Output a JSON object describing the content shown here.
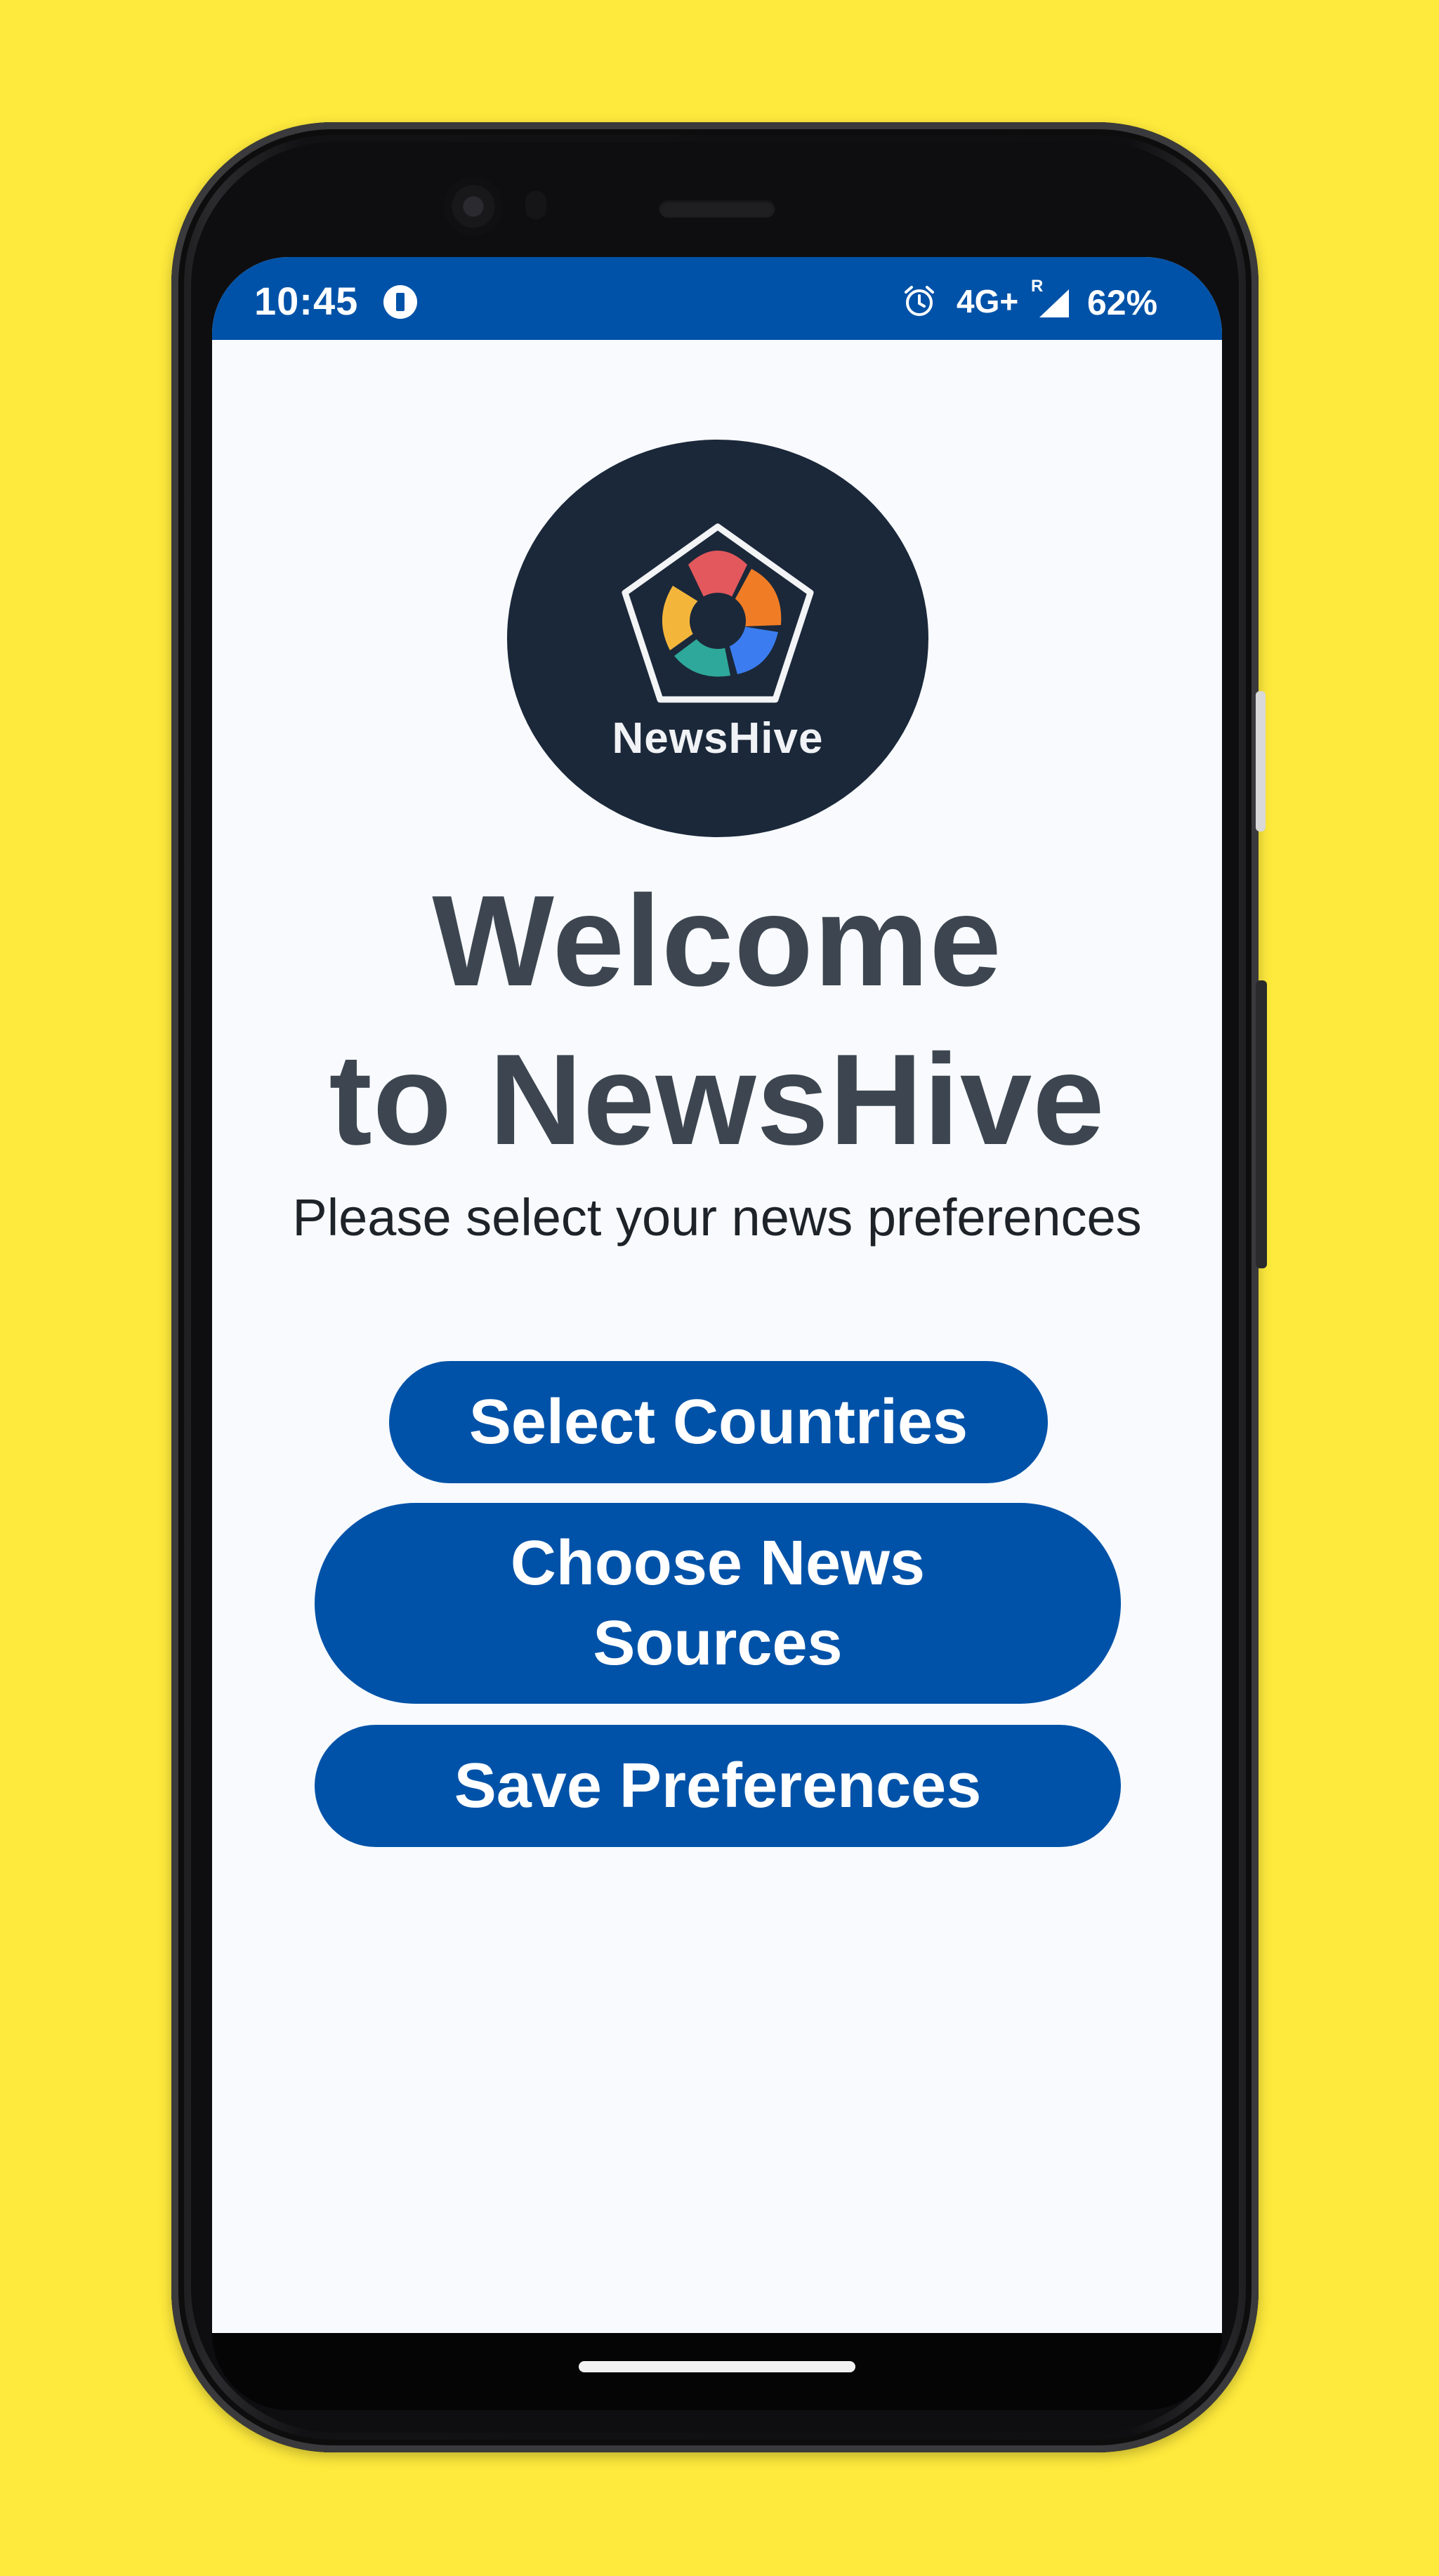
{
  "status_bar": {
    "time": "10:45",
    "network": "4G+",
    "roaming": "R",
    "battery": "62%",
    "icons": [
      "notification-icon",
      "alarm-icon",
      "signal-icon"
    ],
    "color": "#0052A8"
  },
  "app": {
    "logo_text": "NewsHive",
    "welcome_line1": "Welcome",
    "welcome_line2": "to NewsHive",
    "subtitle": "Please select your news preferences"
  },
  "buttons": {
    "select_countries": "Select Countries",
    "choose_sources": "Choose News Sources",
    "save_preferences": "Save Preferences"
  },
  "colors": {
    "accent": "#0052A8",
    "background": "#FEEA3C",
    "screen": "#F8FAFE",
    "title": "#3D4650",
    "logo_bg": "#1B283A"
  }
}
